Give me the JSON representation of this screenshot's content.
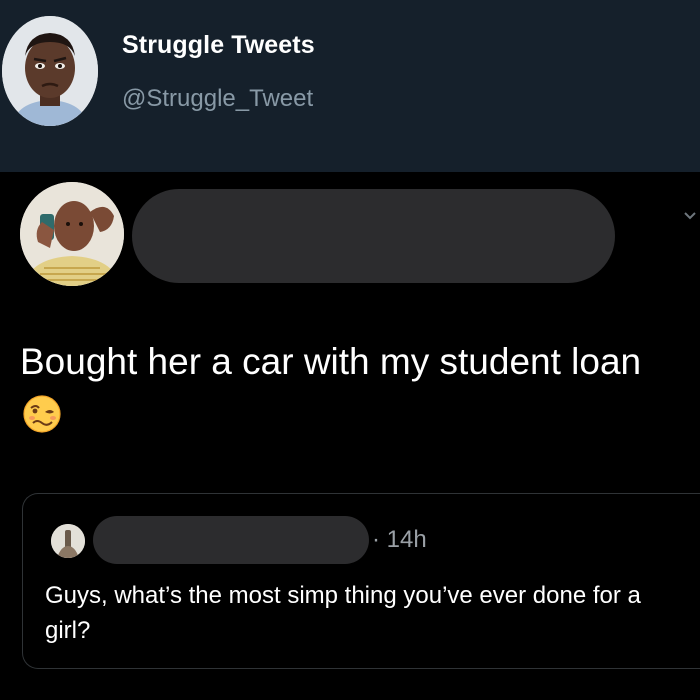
{
  "account": {
    "name": "Struggle Tweets",
    "handle": "@Struggle_Tweet"
  },
  "tweet": {
    "text": "Bought her a car with my student loan",
    "emoji": "woozy-face"
  },
  "quoted_tweet": {
    "time": "· 14h",
    "text": "Guys, what’s the most simp thing you’ve ever done for a girl?"
  },
  "colors": {
    "header_bg": "#15202b",
    "body_bg": "#000000",
    "text": "#ffffff",
    "muted": "#8899a6",
    "redaction": "#2c2c2e"
  }
}
